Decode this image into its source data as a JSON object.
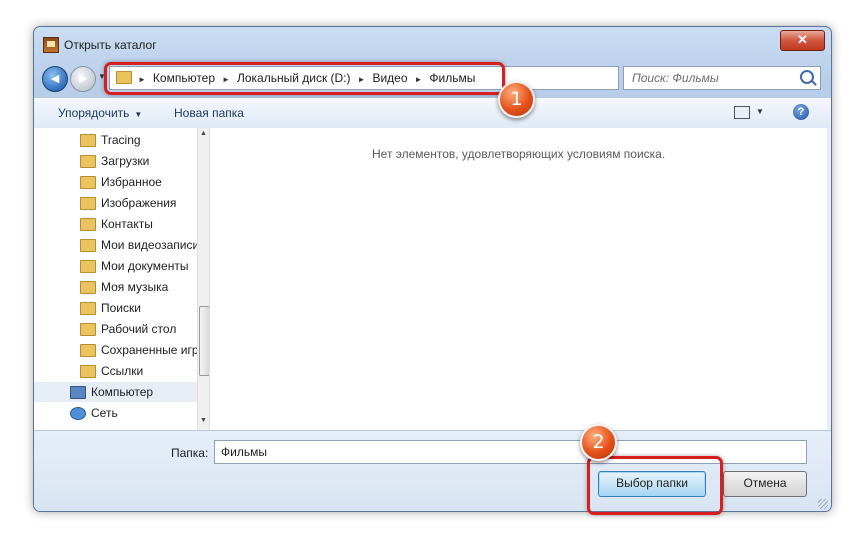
{
  "window": {
    "title": "Открыть каталог",
    "close_label": "✕"
  },
  "nav": {
    "back_glyph": "◄",
    "forward_glyph": "►",
    "breadcrumbs": [
      "Компьютер",
      "Локальный диск (D:)",
      "Видео",
      "Фильмы"
    ],
    "search_placeholder": "Поиск: Фильмы"
  },
  "toolbar": {
    "organize_label": "Упорядочить",
    "new_folder_label": "Новая папка",
    "help_label": "?"
  },
  "tree": {
    "items": [
      {
        "label": "Tracing",
        "icon": "folder-icon"
      },
      {
        "label": "Загрузки",
        "icon": "folder-icon"
      },
      {
        "label": "Избранное",
        "icon": "favorites-folder-icon"
      },
      {
        "label": "Изображения",
        "icon": "folder-icon"
      },
      {
        "label": "Контакты",
        "icon": "contacts-folder-icon"
      },
      {
        "label": "Мои видеозаписи",
        "icon": "folder-icon"
      },
      {
        "label": "Мои документы",
        "icon": "folder-icon"
      },
      {
        "label": "Моя музыка",
        "icon": "folder-icon"
      },
      {
        "label": "Поиски",
        "icon": "search-folder-icon"
      },
      {
        "label": "Рабочий стол",
        "icon": "folder-icon"
      },
      {
        "label": "Сохраненные игры",
        "icon": "folder-icon"
      },
      {
        "label": "Ссылки",
        "icon": "links-folder-icon"
      },
      {
        "label": "Компьютер",
        "icon": "computer-icon"
      },
      {
        "label": "Сеть",
        "icon": "network-icon"
      }
    ]
  },
  "content": {
    "empty_message": "Нет элементов, удовлетворяющих условиям поиска."
  },
  "bottom": {
    "folder_label": "Папка:",
    "folder_value": "Фильмы",
    "select_button": "Выбор папки",
    "cancel_button": "Отмена"
  },
  "annotations": {
    "badge1": "1",
    "badge2": "2",
    "highlight_color": "#d81e1e",
    "badge_color": "#e4511b"
  }
}
